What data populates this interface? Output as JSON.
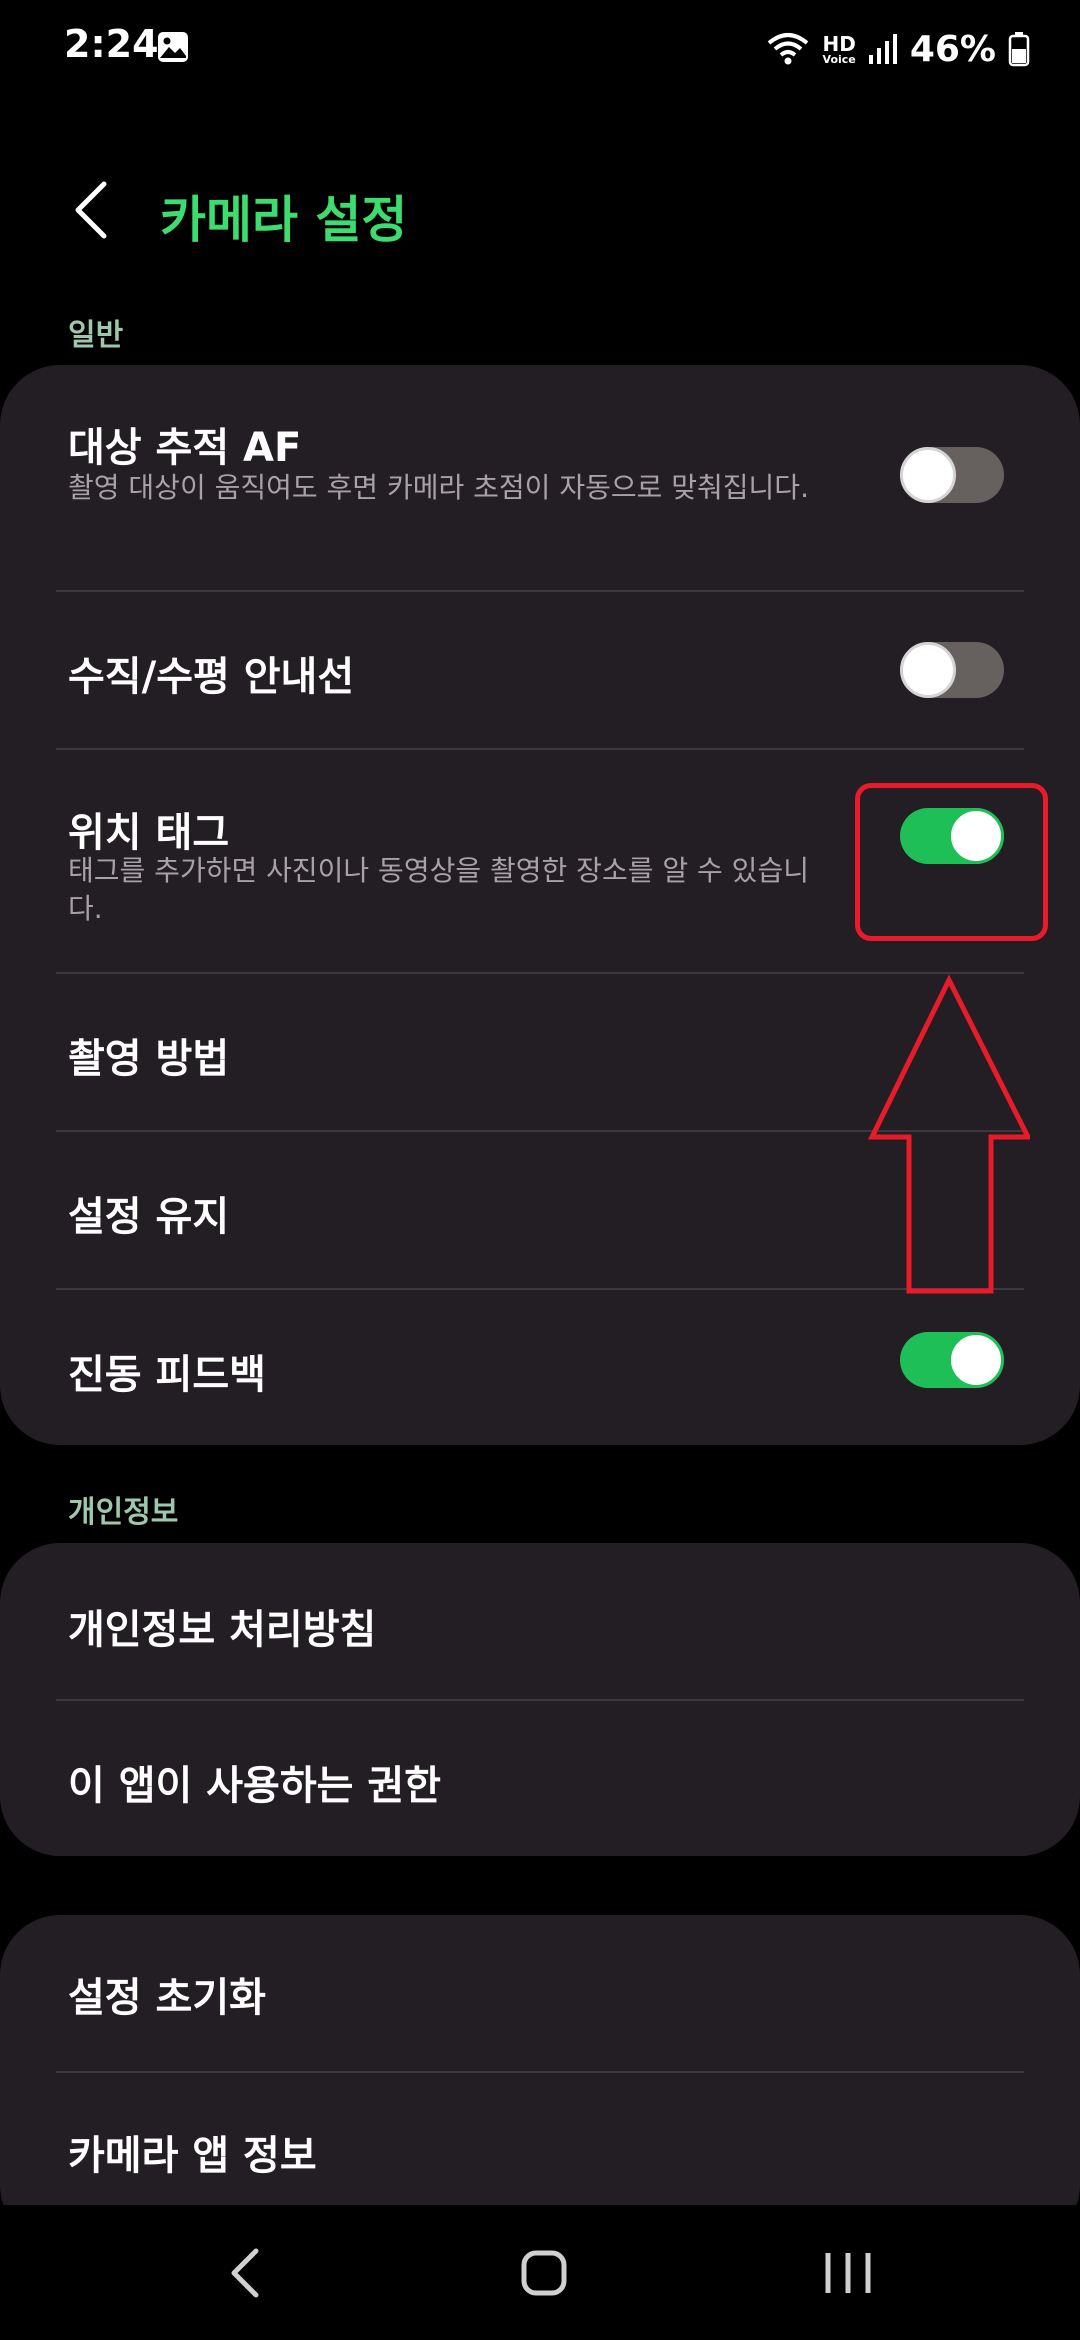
{
  "status_bar": {
    "time": "2:24",
    "hd_label": "HD",
    "voice_label": "Voice",
    "battery_percent": "46%",
    "icons": [
      "gallery-icon",
      "wifi-icon",
      "signal-icon",
      "battery-icon"
    ]
  },
  "header": {
    "title": "카메라 설정",
    "back_icon": "chevron-left-icon"
  },
  "general": {
    "label": "일반",
    "items": [
      {
        "title": "대상 추적 AF",
        "description": "촬영 대상이 움직여도 후면 카메라 초점이 자동으로 맞춰집니다.",
        "toggle": "off"
      },
      {
        "title": "수직/수평 안내선",
        "toggle": "off"
      },
      {
        "title": "위치 태그",
        "description": "태그를 추가하면 사진이나 동영상을 촬영한 장소를 알 수 있습니다.",
        "toggle": "on"
      },
      {
        "title": "촬영 방법"
      },
      {
        "title": "설정 유지"
      },
      {
        "title": "진동 피드백",
        "toggle": "on"
      }
    ]
  },
  "privacy": {
    "label": "개인정보",
    "items": [
      {
        "title": "개인정보 처리방침"
      },
      {
        "title": "이 앱이 사용하는 권한"
      }
    ]
  },
  "other": {
    "items": [
      {
        "title": "설정 초기화"
      },
      {
        "title": "카메라 앱 정보"
      }
    ]
  },
  "nav_bar": {
    "icons": [
      "back-nav-icon",
      "home-nav-icon",
      "recents-nav-icon"
    ]
  },
  "colors": {
    "accent_title": "#3ddc6f",
    "toggle_on": "#1fbf58",
    "toggle_off": "#66615f",
    "card_bg": "#231e23",
    "annotation": "#e81b2a"
  }
}
